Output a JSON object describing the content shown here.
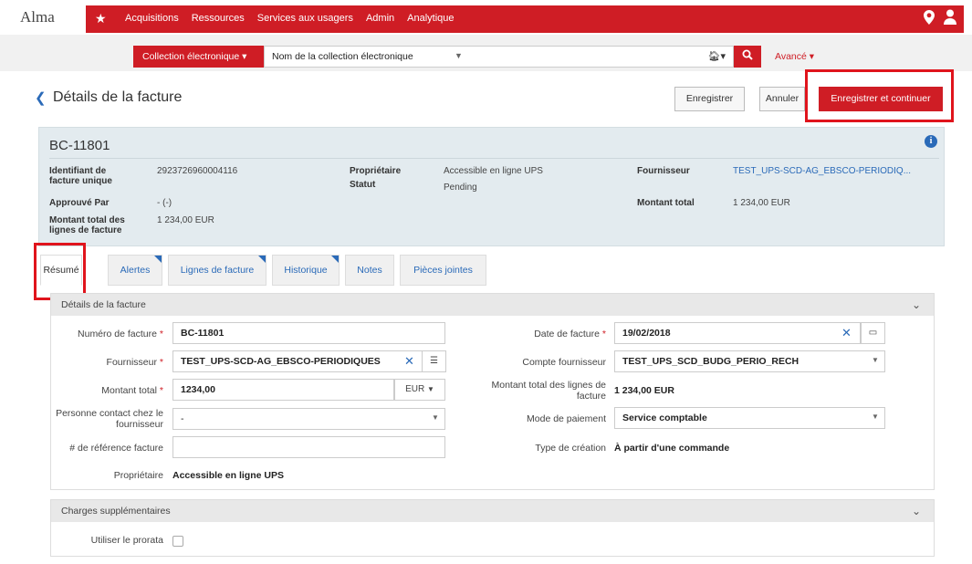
{
  "app": {
    "logo": "Alma"
  },
  "topnav": {
    "items": [
      "Acquisitions",
      "Ressources",
      "Services aux usagers",
      "Admin",
      "Analytique"
    ]
  },
  "search": {
    "collection_select": "Collection électronique ▾",
    "field_label": "Nom de la collection électronique",
    "advanced": "Avancé ▾"
  },
  "page": {
    "title": "Détails de la facture",
    "buttons": {
      "save": "Enregistrer",
      "cancel": "Annuler",
      "save_continue": "Enregistrer et continuer"
    }
  },
  "summary": {
    "title": "BC-11801",
    "fields": {
      "unique_id_label": "Identifiant de facture unique",
      "unique_id": "2923726960004116",
      "approved_label": "Approuvé Par",
      "approved": "- (-)",
      "lines_total_label": "Montant total des lignes de facture",
      "lines_total": "1 234,00 EUR",
      "owner_label": "Propriétaire",
      "owner": "Accessible en ligne UPS",
      "status_label": "Statut",
      "status": "Pending",
      "vendor_label": "Fournisseur",
      "vendor": "TEST_UPS-SCD-AG_EBSCO-PERIODIQ...",
      "total_label": "Montant total",
      "total": "1 234,00 EUR"
    }
  },
  "tabs": [
    "Résumé",
    "Alertes",
    "Lignes de facture",
    "Historique",
    "Notes",
    "Pièces jointes"
  ],
  "details": {
    "header": "Détails de la facture",
    "invoice_number_label": "Numéro de facture",
    "invoice_number": "BC-11801",
    "vendor_label": "Fournisseur",
    "vendor": "TEST_UPS-SCD-AG_EBSCO-PERIODIQUES",
    "total_label": "Montant total",
    "total": "1234,00",
    "currency": "EUR",
    "contact_label": "Personne contact chez le fournisseur",
    "contact": "-",
    "reference_label": "# de référence facture",
    "reference": "",
    "owner_label": "Propriétaire",
    "owner": "Accessible en ligne UPS",
    "date_label": "Date de facture",
    "date": "19/02/2018",
    "account_label": "Compte fournisseur",
    "account": "TEST_UPS_SCD_BUDG_PERIO_RECH",
    "lines_total_label": "Montant total des lignes de facture",
    "lines_total": "1 234,00 EUR",
    "payment_label": "Mode de paiement",
    "payment": "Service comptable",
    "creation_label": "Type de création",
    "creation": "À partir d'une commande",
    "required_mark": "*"
  },
  "charges": {
    "header": "Charges supplémentaires",
    "prorata_label": "Utiliser le prorata"
  },
  "colors": {
    "brand": "#cf1d25",
    "link": "#2a6ab8",
    "panel": "#e3ebef"
  }
}
